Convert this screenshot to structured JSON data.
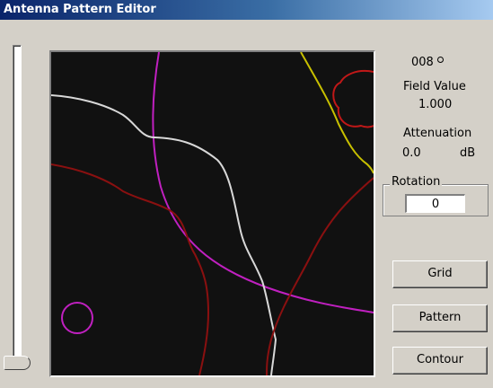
{
  "window": {
    "title": "Antenna Pattern Editor"
  },
  "readout": {
    "angle": "008",
    "field_value_label": "Field Value",
    "field_value": "1.000",
    "attenuation_label": "Attenuation",
    "attenuation_value": "0.0",
    "attenuation_unit": "dB"
  },
  "rotation": {
    "label": "Rotation",
    "value": "0"
  },
  "buttons": {
    "grid": "Grid",
    "pattern": "Pattern",
    "contour": "Contour"
  },
  "colors": {
    "plot_background": "#111111",
    "white_trace": "#d8d8d8",
    "magenta_trace": "#c020c0",
    "darkred_trace": "#8a1010",
    "red_trace": "#c01818",
    "yellow_trace": "#c8c000"
  }
}
